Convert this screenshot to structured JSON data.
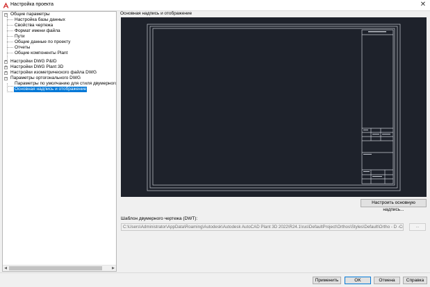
{
  "window": {
    "title": "Настройка проекта",
    "close_glyph": "✕"
  },
  "tree": {
    "root1": {
      "label": "Общие параметры",
      "children": [
        "Настройка базы данных",
        "Свойства чертежа",
        "Формат имени файла",
        "Пути",
        "Общие данные по проекту",
        "Отчеты",
        "Общие компоненты Plant"
      ]
    },
    "collapsed": [
      "Настройки DWG P&ID",
      "Настройки DWG Plant 3D",
      "Настройки изометрического файла DWG"
    ],
    "root2": {
      "label": "Параметры ортогонального DWG",
      "children": [
        "Параметры по умолчанию для стиля двумерного чер",
        "Основная надпись и отображение"
      ]
    },
    "selected": "Основная надпись и отображение"
  },
  "main": {
    "section_title": "Основная надпись и отображение",
    "configure_button": "Настроить основную надпись...",
    "template_label": "Шаблон двумерного чертежа (DWT):",
    "template_path": "C:\\Users\\Administrator\\AppData\\Roaming\\Autodesk\\Autodesk AutoCAD Plant 3D 2022\\R24.1\\rus\\DefaultProject\\Orthos\\Styles\\Default\\Ortho - D -Color Depen",
    "browse_button": "..."
  },
  "footer": {
    "apply": "Применить",
    "ok": "OK",
    "cancel": "Отмена",
    "help": "Справка"
  },
  "colors": {
    "accent": "#0078d7",
    "preview_bg": "#1e222b",
    "preview_lines": "#c8ccd4"
  }
}
